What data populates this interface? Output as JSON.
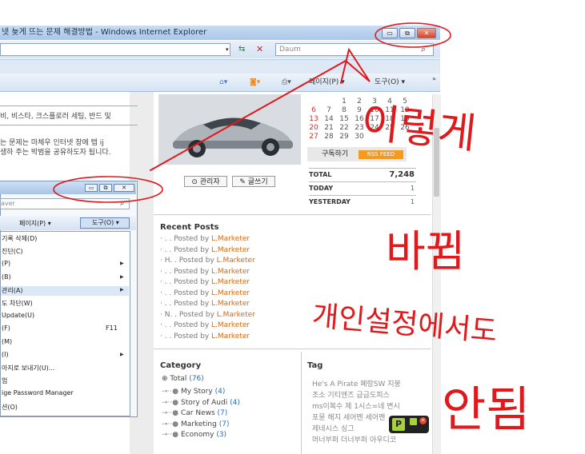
{
  "window": {
    "title": "넷 늦게 뜨는 문제 해결방법 - Windows Internet Explorer",
    "min": "▭",
    "max": "⧉",
    "close": "✕"
  },
  "addressbar": {
    "search_placeholder": "Daum",
    "refresh_icon": "⇆",
    "stop_icon": "✕",
    "search_icon": "⌕"
  },
  "cmdbar": {
    "page_label": "페이지(P) ▾",
    "tools_label": "도구(O) ▾"
  },
  "article": {
    "text1": "비, 비스타, 크스플로러 세팅, 반드 및",
    "text2_line1": "는 문제는 마체우 인터넷 창에 텝 ij",
    "text2_line2": "생하 주는 박범을 공유하도자 됩니다."
  },
  "buttons": {
    "admin": "⊙ 관리자",
    "write": "✎ 글쓰기"
  },
  "calendar": {
    "rows": [
      [
        "",
        "",
        "",
        "1",
        "2",
        "3",
        "4",
        "5"
      ],
      [
        "6",
        "7",
        "8",
        "9",
        "10",
        "11",
        "12"
      ],
      [
        "13",
        "14",
        "15",
        "16",
        "17",
        "18",
        "19"
      ],
      [
        "20",
        "21",
        "22",
        "23",
        "24",
        "25",
        "26"
      ],
      [
        "27",
        "28",
        "29",
        "30",
        "",
        "",
        ""
      ]
    ]
  },
  "subscribe": {
    "label": "구독하기",
    "rss": "RSS FEED"
  },
  "stats": {
    "total_label": "TOTAL",
    "total": "7,248",
    "today_label": "TODAY",
    "today": "1",
    "yesterday_label": "YESTERDAY",
    "yesterday": "1"
  },
  "recent": {
    "title": "Recent Posts",
    "prefix_by": "Posted by",
    "items": [
      {
        "lead": "· . .",
        "author": "L.Marketer"
      },
      {
        "lead": "· . .",
        "author": "L.Marketer"
      },
      {
        "lead": "· H. .",
        "author": "L.Marketer"
      },
      {
        "lead": "· . .",
        "author": "L.Marketer"
      },
      {
        "lead": "· . .",
        "author": "L.Marketer"
      },
      {
        "lead": "· . .",
        "author": "L.Marketer"
      },
      {
        "lead": "· . .",
        "author": "L.Marketer"
      },
      {
        "lead": "· N. .",
        "author": "L.Marketer"
      },
      {
        "lead": "· . .",
        "author": "L.Marketer"
      },
      {
        "lead": "· . .",
        "author": "L.Marketer"
      }
    ]
  },
  "category": {
    "title": "Category",
    "total": "Total",
    "total_count": "(76)",
    "items": [
      {
        "label": "My Story",
        "count": "(4)"
      },
      {
        "label": "Story of Audi",
        "count": "(4)"
      },
      {
        "label": "Car News",
        "count": "(7)"
      },
      {
        "label": "Marketing",
        "count": "(7)"
      },
      {
        "label": "Economy",
        "count": "(3)"
      }
    ]
  },
  "tag": {
    "title": "Tag",
    "lines": [
      "He's  A  Pirate   폐랑SW   지붕",
      "조소     기티엔즈     급급도피스",
      "ms이복수   제 1시스=네   변시",
      "포뮨   해지   세어멘   세어멘",
      "제네시스     싱그",
      "머너부퍼   더너부퍼   아우디코"
    ]
  },
  "popup": {
    "search_placeholder": "aver",
    "page_label": "페이지(P) ▾",
    "tools_label": "도구(O) ▾",
    "menu": [
      "기록 삭제(D)",
      "진단(C)",
      "(P)",
      "(B)",
      "관리(A)",
      "도 차단(W)",
      "Update(U)",
      "(F)",
      "(M)",
      "(I)",
      "아지로 보내기(U)...",
      "업",
      "ige Password Manager",
      "션(O)"
    ],
    "f11": "F11"
  },
  "annotation": {
    "line1": "이렇게",
    "line2": "바뀜",
    "line3": "개인설정에서도",
    "line4": "안됨"
  },
  "colors": {
    "annotation": "#e0191c",
    "author": "#d06a1a",
    "count": "#2a6db5"
  }
}
